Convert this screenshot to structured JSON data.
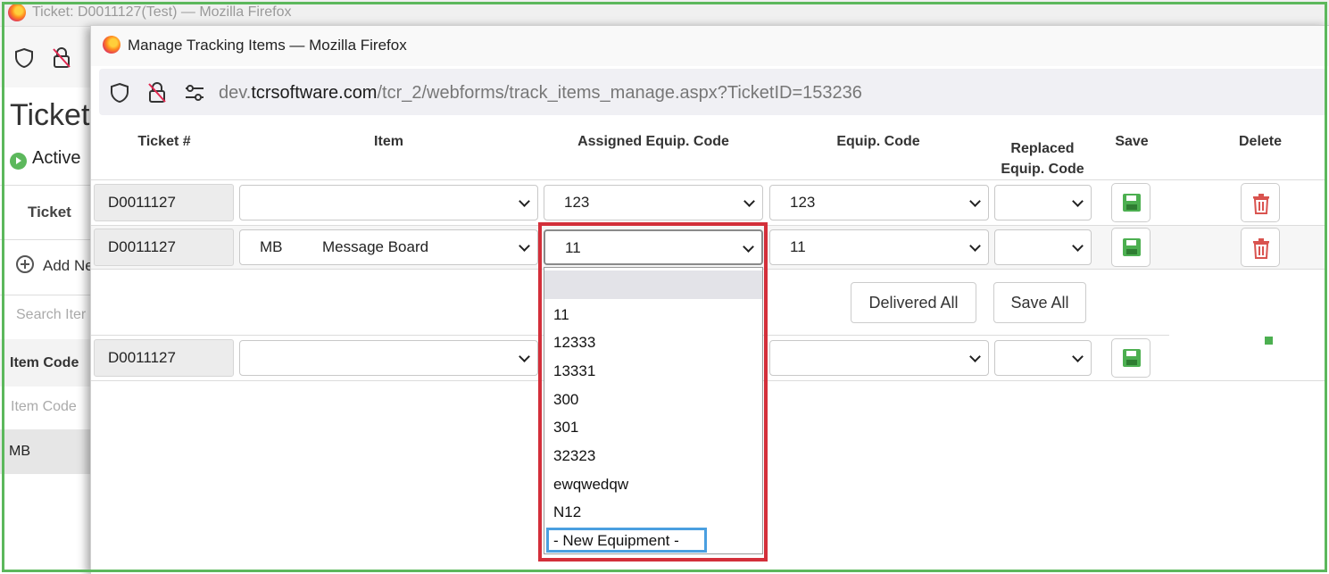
{
  "background_window": {
    "title": "Ticket: D0011127(Test) — Mozilla Firefox",
    "page_title": "Ticket",
    "status": "Active",
    "tab_label": "Ticket",
    "add_new_label": "Add Ne",
    "search_placeholder": "Search Iter",
    "item_code_header": "Item Code",
    "item_code_filter_placeholder": "Item Code",
    "row_item_code": "MB"
  },
  "popup": {
    "title": "Manage Tracking Items — Mozilla Firefox",
    "url_prefix": "dev.",
    "url_domain": "tcrsoftware.com",
    "url_path": "/tcr_2/webforms/track_items_manage.aspx?TicketID=153236"
  },
  "table": {
    "headers": {
      "ticket": "Ticket #",
      "item": "Item",
      "assigned_equip": "Assigned Equip. Code",
      "equip": "Equip. Code",
      "replaced_line1": "Replaced",
      "replaced_line2": "Equip. Code",
      "save": "Save",
      "delete": "Delete"
    },
    "rows": [
      {
        "ticket": "D0011127",
        "item_code": "",
        "item_name": "",
        "assigned": "123",
        "equip": "123",
        "replaced": ""
      },
      {
        "ticket": "D0011127",
        "item_code": "MB",
        "item_name": "Message Board",
        "assigned": "11",
        "equip": "11",
        "replaced": ""
      },
      {
        "ticket": "D0011127",
        "item_code": "",
        "item_name": "",
        "assigned": "",
        "equip": "",
        "replaced": ""
      }
    ],
    "delivered_all_label": "Delivered All",
    "save_all_label": "Save All"
  },
  "dropdown": {
    "options": [
      "",
      "11",
      "12333",
      "13331",
      "300",
      "301",
      "32323",
      "ewqwedqw",
      "N12",
      "- New Equipment -"
    ],
    "focused_option": "- New Equipment -"
  },
  "colors": {
    "outer_highlight": "#5cb85c",
    "dropdown_highlight": "#d32f3a",
    "focus_highlight": "#4a9fe0",
    "save_icon": "#4caf50",
    "delete_icon": "#d9534f"
  }
}
